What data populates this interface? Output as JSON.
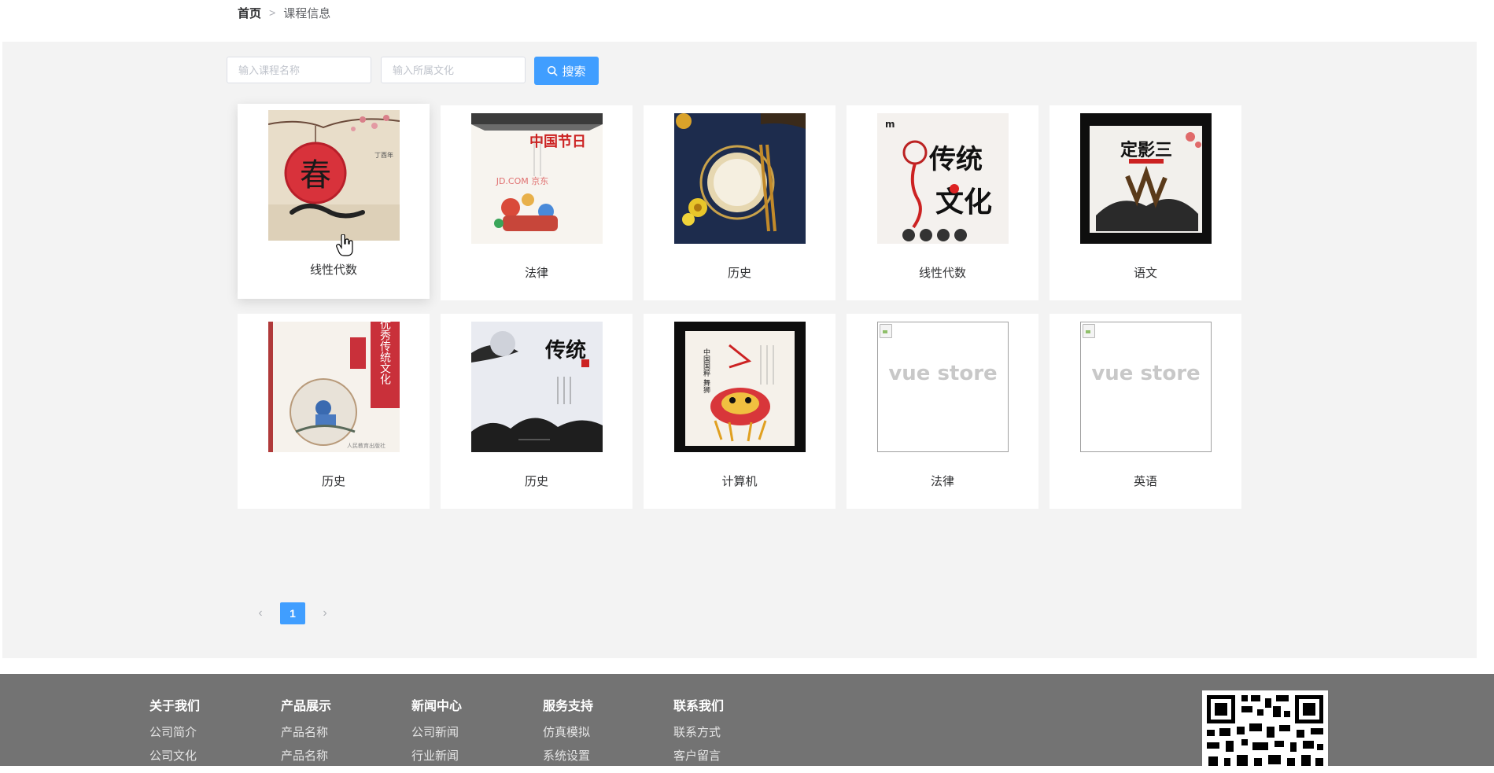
{
  "breadcrumb": {
    "home": "首页",
    "separator": ">",
    "current": "课程信息"
  },
  "search": {
    "name_placeholder": "输入课程名称",
    "culture_placeholder": "输入所属文化",
    "button_label": "搜索",
    "button_icon": "search-icon"
  },
  "courses": [
    {
      "name": "线性代数",
      "image": "poster-spring-lantern"
    },
    {
      "name": "法律",
      "image": "poster-china-festival"
    },
    {
      "name": "历史",
      "image": "poster-table-setting"
    },
    {
      "name": "线性代数",
      "image": "poster-traditional-culture"
    },
    {
      "name": "语文",
      "image": "poster-ink-calligraphy"
    },
    {
      "name": "历史",
      "image": "poster-chinese-traditional-culture-book"
    },
    {
      "name": "历史",
      "image": "poster-ink-mountains"
    },
    {
      "name": "计算机",
      "image": "poster-lion-dance"
    },
    {
      "name": "法律",
      "image": "broken-image",
      "broken_text": "vue store"
    },
    {
      "name": "英语",
      "image": "broken-image",
      "broken_text": "vue store"
    }
  ],
  "poster_text": {
    "spring": "春",
    "festival_title": "中国节日",
    "festival_watermark": "JD.COM 京东",
    "culture_big": "传统文化",
    "culture_logo": "m",
    "ink_title": "定影三",
    "book_title": "中华优秀传统文化",
    "ink_mountain_title": "传统",
    "lion_dance_title": "中国国粹 舞狮"
  },
  "pagination": {
    "current": "1",
    "prev_icon": "chevron-left-icon",
    "next_icon": "chevron-right-icon"
  },
  "footer": {
    "columns": [
      {
        "title": "关于我们",
        "links": [
          "公司简介",
          "公司文化"
        ]
      },
      {
        "title": "产品展示",
        "links": [
          "产品名称",
          "产品名称"
        ]
      },
      {
        "title": "新闻中心",
        "links": [
          "公司新闻",
          "行业新闻"
        ]
      },
      {
        "title": "服务支持",
        "links": [
          "仿真模拟",
          "系统设置"
        ]
      },
      {
        "title": "联系我们",
        "links": [
          "联系方式",
          "客户留言"
        ]
      }
    ],
    "qr_icon": "qr-code-icon"
  },
  "colors": {
    "primary": "#409eff",
    "panel_bg": "#f3f3f3",
    "footer_bg": "#737373"
  }
}
